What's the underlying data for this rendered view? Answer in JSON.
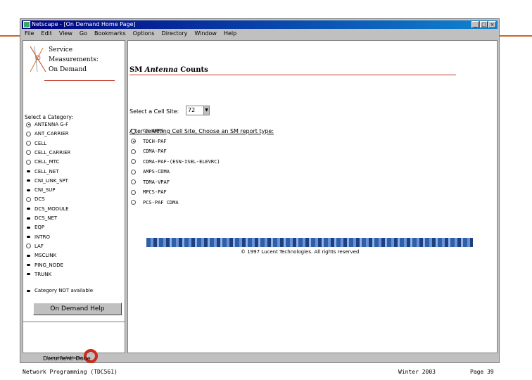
{
  "window": {
    "title": "Netscape - [On Demand Home Page]"
  },
  "menu": [
    "File",
    "Edit",
    "View",
    "Go",
    "Bookmarks",
    "Options",
    "Directory",
    "Window",
    "Help"
  ],
  "brand": {
    "line1": "Service",
    "line2": "Measurements:",
    "line3": "On Demand"
  },
  "left": {
    "category_title": "Select a Category:",
    "categories": [
      {
        "label": "ANTENNA G-F",
        "marker": "radio-selected"
      },
      {
        "label": "ANT_CARRIER",
        "marker": "radio"
      },
      {
        "label": "CELL",
        "marker": "radio"
      },
      {
        "label": "CELL_CARRIER",
        "marker": "radio"
      },
      {
        "label": "CELL_MTC",
        "marker": "radio"
      },
      {
        "label": "CELL_NET",
        "marker": "bullet"
      },
      {
        "label": "CNI_LINK_SPT",
        "marker": "bullet"
      },
      {
        "label": "CNI_SUP",
        "marker": "bullet"
      },
      {
        "label": "DCS",
        "marker": "radio"
      },
      {
        "label": "DCS_MODULE",
        "marker": "bullet"
      },
      {
        "label": "DCS_NET",
        "marker": "bullet"
      },
      {
        "label": "EQP",
        "marker": "bullet"
      },
      {
        "label": "INTRO",
        "marker": "bullet"
      },
      {
        "label": "LAF",
        "marker": "radio"
      },
      {
        "label": "MSCLINK",
        "marker": "bullet"
      },
      {
        "label": "PING_NODE",
        "marker": "bullet"
      },
      {
        "label": "TRUNK",
        "marker": "bullet"
      }
    ],
    "legend": "Category NOT available",
    "help_button": "On Demand Help",
    "vendor": "Lucent Technologies"
  },
  "right": {
    "title_prefix": "SM",
    "title_italic": "Antenna",
    "title_suffix": "Counts",
    "cell_site_label": "Select a Cell Site:",
    "cell_site_value": "72",
    "instruction": "After selecting Cell Site, Choose an SM report type:",
    "report_types": [
      {
        "label": "CS-AMPS",
        "selected": false
      },
      {
        "label": "TDCH-PAF",
        "selected": true
      },
      {
        "label": "CDMA-PAF",
        "selected": false
      },
      {
        "label": "CDMA-PAF-(ESN-ISEL-ELEVRC)",
        "selected": false
      },
      {
        "label": "AMPS-CDMA",
        "selected": false
      },
      {
        "label": "TDMA-VPAF",
        "selected": false
      },
      {
        "label": "MPCS-PAF",
        "selected": false
      },
      {
        "label": "PCS-PAF CDMA",
        "selected": false
      }
    ],
    "copyright": "© 1997 Lucent Technologies. All rights reserved"
  },
  "status": {
    "text": "Document: Done"
  },
  "footer": {
    "left": "Network Programming (TDC561)",
    "center": "Winter 2003",
    "right": "Page 39"
  },
  "colors": {
    "accent_line": "#c9652a",
    "titlebar": "#000080",
    "help_button": "#c0c0c0"
  }
}
